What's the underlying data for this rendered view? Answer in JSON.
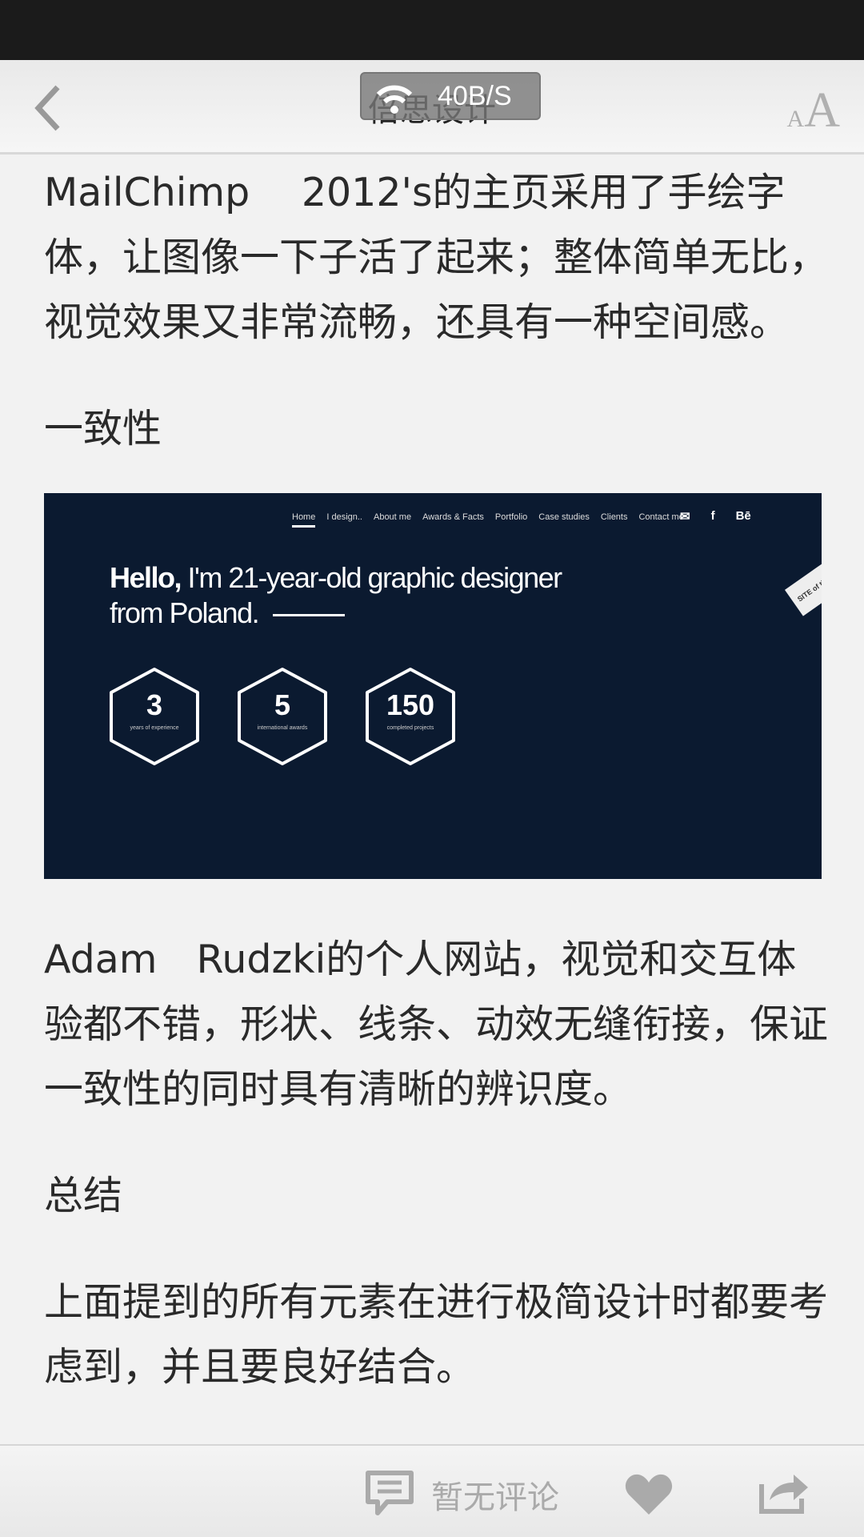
{
  "status_bar": {},
  "header": {
    "title": "倍思设计",
    "network_speed": "40B/S",
    "font_size_label": {
      "small": "A",
      "large": "A"
    }
  },
  "article": {
    "paragraphs": [
      "MailChimp　 2012's的主页采用了手绘字体，让图像一下子活了起来；整体简单无比，视觉效果又非常流畅，还具有一种空间感。",
      "一致性",
      "Adam　Rudzki的个人网站，视觉和交互体验都不错，形状、线条、动效无缝衔接，保证一致性的同时具有清晰的辨识度。",
      "总结",
      "上面提到的所有元素在进行极简设计时都要考虑到，并且要良好结合。"
    ],
    "image": {
      "nav": [
        "Home",
        "I design..",
        "About me",
        "Awards & Facts",
        "Portfolio",
        "Case studies",
        "Clients",
        "Contact me"
      ],
      "social": [
        "✉",
        "f",
        "Bē"
      ],
      "hello_bold": "Hello,",
      "hello_rest": " I'm 21-year-old graphic designer",
      "hello_line2": "from Poland.",
      "stats": [
        {
          "number": "3",
          "caption": "years of experience"
        },
        {
          "number": "5",
          "caption": "international awards"
        },
        {
          "number": "150",
          "caption": "completed projects"
        }
      ],
      "ribbon": "SITE of the DAY",
      "background_color": "#0b1a30"
    }
  },
  "bottom_bar": {
    "comment_label": "暂无评论",
    "icons": [
      "comment-icon",
      "heart-icon",
      "share-icon"
    ]
  }
}
